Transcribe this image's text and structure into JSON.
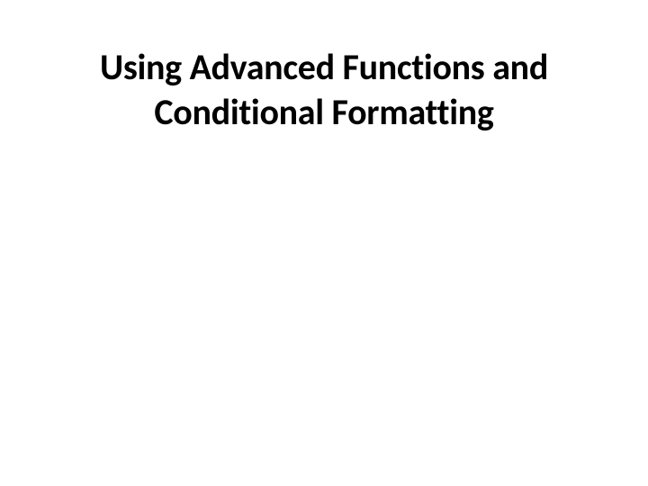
{
  "slide": {
    "title": "Using Advanced Functions and Conditional Formatting"
  }
}
